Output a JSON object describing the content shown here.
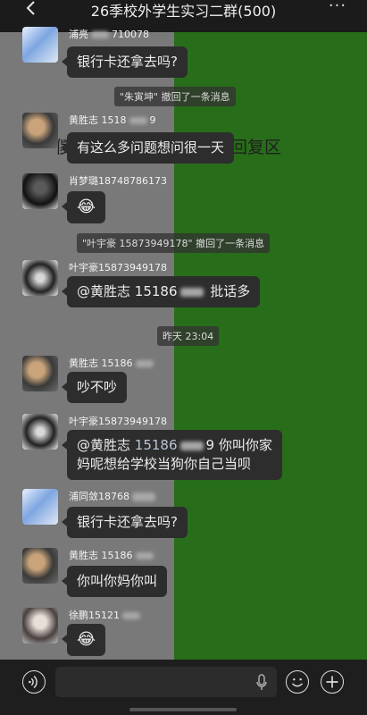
{
  "header": {
    "title": "26季校外学生实习二群(500)",
    "more": "···"
  },
  "ghost_text": {
    "left": "儍",
    "right": "回复区"
  },
  "messages": [
    {
      "sender": "浦亮",
      "sender_tail": "710078",
      "text": "银行卡还拿去吗?"
    },
    {
      "sender": "黄胜志 1518",
      "sender_tail": "9",
      "text": "有这么多问题想问很一天"
    },
    {
      "sender": "肖梦璐18748786173",
      "text": "😂"
    },
    {
      "sender": "叶宇豪15873949178",
      "mention": "@黄胜志",
      "mention_num": "15186",
      "text": "批话多"
    },
    {
      "sender": "黄胜志 15186",
      "text": "吵不吵"
    },
    {
      "sender": "叶宇豪15873949178",
      "mention": "@黄胜志",
      "mention_num": "15186",
      "mention_tail": "9",
      "text": "你叫你家",
      "text2": "妈呢想给学校当狗你自己当呗"
    },
    {
      "sender": "浦同敛18768",
      "text": "银行卡还拿去吗?"
    },
    {
      "sender": "黄胜志 15186",
      "text": "你叫你妈你叫"
    },
    {
      "sender": "徐鹏15121",
      "text": "😂"
    }
  ],
  "system": [
    "\"朱寅坤\" 撤回了一条消息",
    "\"叶宇豪 15873949178\" 撤回了一条消息",
    "昨天 23:04"
  ],
  "colors": {
    "bubble": "#2d2d2d",
    "green_bg": "#2e7d1e",
    "gray_bg": "#8a8a8a"
  },
  "icons": [
    "back-icon",
    "more-icon",
    "voice-icon",
    "mic-icon",
    "emoji-icon",
    "plus-icon"
  ]
}
